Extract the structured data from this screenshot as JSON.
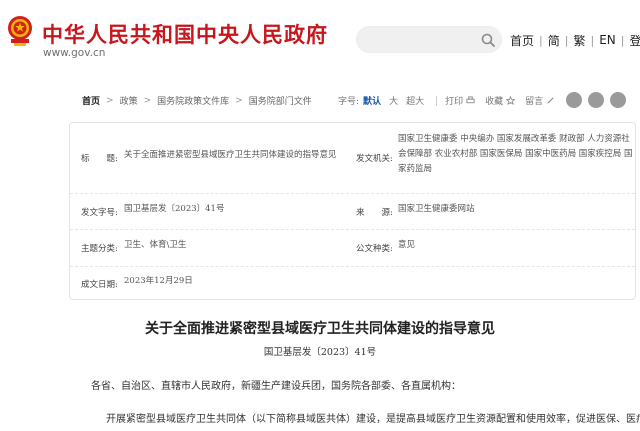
{
  "header": {
    "site_title": "中华人民共和国中央人民政府",
    "site_url": "www.gov.cn",
    "search_placeholder": "",
    "nav": [
      "首页",
      "简",
      "繁",
      "EN",
      "登录"
    ]
  },
  "breadcrumb": [
    "首页",
    "政策",
    "国务院政策文件库",
    "国务院部门文件"
  ],
  "tools": {
    "font_label": "字号:",
    "font_default": "默认",
    "font_large": "大",
    "font_xlarge": "超大",
    "print": "打印",
    "favorite": "收藏",
    "leave": "留言"
  },
  "info": {
    "title_label": "标　　题:",
    "title_value": "关于全面推进紧密型县域医疗卫生共同体建设的指导意见",
    "issuer_label": "发文机关:",
    "issuer_lines": [
      "国家卫生健康委  中央编办  国家发展改革委  财政部  人力资源社",
      "会保障部  农业农村部  国家医保局  国家中医药局  国家疾控局  国",
      "家药监局"
    ],
    "docno_label": "发文字号:",
    "docno_value": "国卫基层发〔2023〕41号",
    "source_label": "来　　源:",
    "source_value": "国家卫生健康委网站",
    "topic_label": "主题分类:",
    "topic_value": "卫生、体育\\卫生",
    "genre_label": "公文种类:",
    "genre_value": "意见",
    "date_label": "成文日期:",
    "date_value": "2023年12月29日"
  },
  "document": {
    "title": "关于全面推进紧密型县域医疗卫生共同体建设的指导意见",
    "number": "国卫基层发〔2023〕41号",
    "salutation": "各省、自治区、直辖市人民政府，新疆生产建设兵团，国务院各部委、各直属机构：",
    "paragraph": "开展紧密型县域医疗卫生共同体（以下简称县域医共体）建设，是提高县域医疗卫生资源配置和使用效率，促进医保、医疗、医"
  },
  "colors": {
    "brand_red": "#c8161d",
    "link_blue": "#1a5aa8"
  }
}
